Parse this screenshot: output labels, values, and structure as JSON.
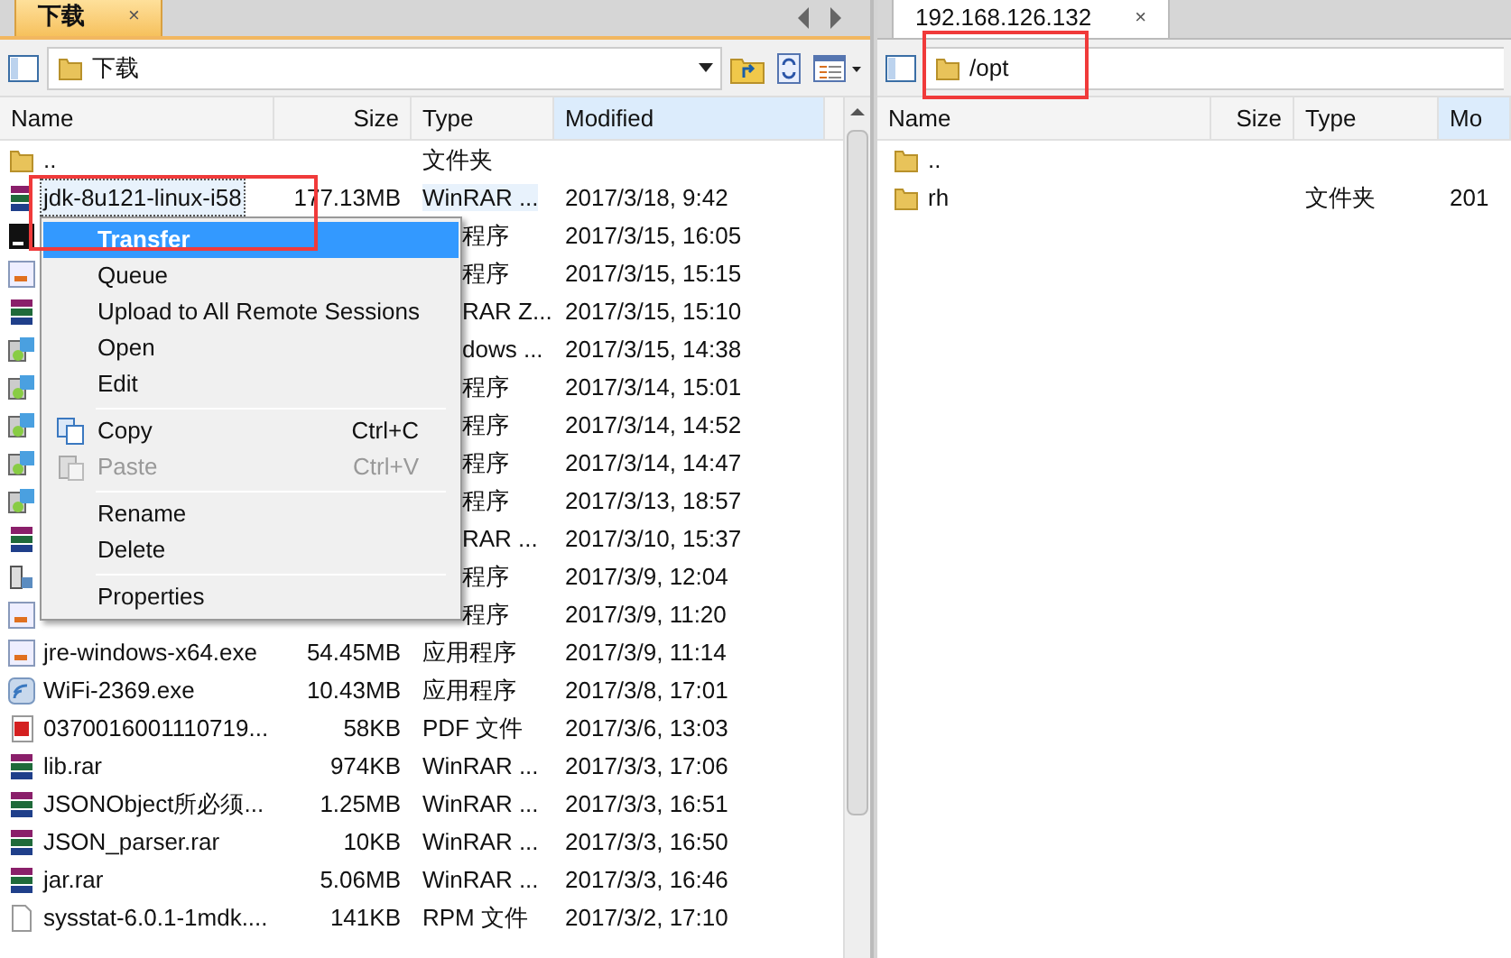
{
  "left_pane": {
    "tab": {
      "label": "下载",
      "close": "×",
      "selected": true
    },
    "path": "下载",
    "columns": [
      "Name",
      "Size",
      "Type",
      "Modified"
    ],
    "rows": [
      {
        "kind": "folder",
        "name": "..",
        "type": "文件夹",
        "selected": false
      },
      {
        "kind": "archive",
        "name": "jdk-8u121-linux-i58",
        "size": "177.13MB",
        "type": "WinRAR ...",
        "modified": "2017/3/18, 9:42",
        "selected": true
      },
      {
        "kind": "app",
        "type": "程序",
        "modified": "2017/3/15, 16:05",
        "selected": false
      },
      {
        "kind": "java",
        "type": "程序",
        "modified": "2017/3/15, 15:15",
        "selected": false
      },
      {
        "kind": "archive",
        "type": "RAR Z...",
        "modified": "2017/3/15, 15:10",
        "selected": false
      },
      {
        "kind": "installer",
        "type": "dows ...",
        "modified": "2017/3/15, 14:38",
        "selected": false
      },
      {
        "kind": "installer",
        "type": "程序",
        "modified": "2017/3/14, 15:01",
        "selected": false
      },
      {
        "kind": "installer",
        "type": "程序",
        "modified": "2017/3/14, 14:52",
        "selected": false
      },
      {
        "kind": "installer",
        "type": "程序",
        "modified": "2017/3/14, 14:47",
        "selected": false
      },
      {
        "kind": "installer",
        "type": "程序",
        "modified": "2017/3/13, 18:57",
        "selected": false
      },
      {
        "kind": "archive",
        "type": "RAR ...",
        "modified": "2017/3/10, 15:37",
        "selected": false
      },
      {
        "kind": "setup",
        "type": "程序",
        "modified": "2017/3/9, 12:04",
        "selected": false
      },
      {
        "kind": "java",
        "type": "程序",
        "modified": "2017/3/9, 11:20",
        "selected": false
      },
      {
        "kind": "java",
        "name": "jre-windows-x64.exe",
        "size": "54.45MB",
        "type": "应用程序",
        "modified": "2017/3/9, 11:14",
        "selected": false
      },
      {
        "kind": "wifi",
        "name": "WiFi-2369.exe",
        "size": "10.43MB",
        "type": "应用程序",
        "modified": "2017/3/8, 17:01",
        "selected": false
      },
      {
        "kind": "pdf",
        "name": "0370016001110719...",
        "size": "58KB",
        "type": "PDF 文件",
        "modified": "2017/3/6, 13:03",
        "selected": false
      },
      {
        "kind": "archive",
        "name": "lib.rar",
        "size": "974KB",
        "type": "WinRAR ...",
        "modified": "2017/3/3, 17:06",
        "selected": false
      },
      {
        "kind": "archive",
        "name": "JSONObject所必须...",
        "size": "1.25MB",
        "type": "WinRAR ...",
        "modified": "2017/3/3, 16:51",
        "selected": false
      },
      {
        "kind": "archive",
        "name": "JSON_parser.rar",
        "size": "10KB",
        "type": "WinRAR ...",
        "modified": "2017/3/3, 16:50",
        "selected": false
      },
      {
        "kind": "archive",
        "name": "jar.rar",
        "size": "5.06MB",
        "type": "WinRAR ...",
        "modified": "2017/3/3, 16:46",
        "selected": false
      },
      {
        "kind": "file",
        "name": "sysstat-6.0.1-1mdk....",
        "size": "141KB",
        "type": "RPM 文件",
        "modified": "2017/3/2, 17:10",
        "selected": false
      }
    ]
  },
  "context_menu": [
    {
      "kind": "item",
      "label": "Transfer",
      "selected": true,
      "disabled": false
    },
    {
      "kind": "item",
      "label": "Queue",
      "selected": false,
      "disabled": false
    },
    {
      "kind": "item",
      "label": "Upload to All Remote Sessions",
      "selected": false,
      "disabled": false
    },
    {
      "kind": "item",
      "label": "Open",
      "selected": false,
      "disabled": false
    },
    {
      "kind": "item",
      "label": "Edit",
      "selected": false,
      "disabled": false
    },
    {
      "kind": "separator"
    },
    {
      "kind": "copy",
      "label": "Copy",
      "shortcut": "Ctrl+C",
      "selected": false,
      "disabled": false
    },
    {
      "kind": "paste",
      "label": "Paste",
      "shortcut": "Ctrl+V",
      "selected": false,
      "disabled": true
    },
    {
      "kind": "separator"
    },
    {
      "kind": "item",
      "label": "Rename",
      "selected": false,
      "disabled": false
    },
    {
      "kind": "item",
      "label": "Delete",
      "selected": false,
      "disabled": false
    },
    {
      "kind": "separator"
    },
    {
      "kind": "item",
      "label": "Properties",
      "selected": false,
      "disabled": false
    }
  ],
  "right_pane": {
    "tab": {
      "label": "192.168.126.132",
      "close": "×",
      "selected": false
    },
    "path": "/opt",
    "columns": [
      "Name",
      "Size",
      "Type",
      "Mo"
    ],
    "rows": [
      {
        "kind": "folder",
        "name": ".."
      },
      {
        "kind": "folder",
        "name": "rh",
        "type": "文件夹",
        "modified": "201"
      }
    ]
  }
}
